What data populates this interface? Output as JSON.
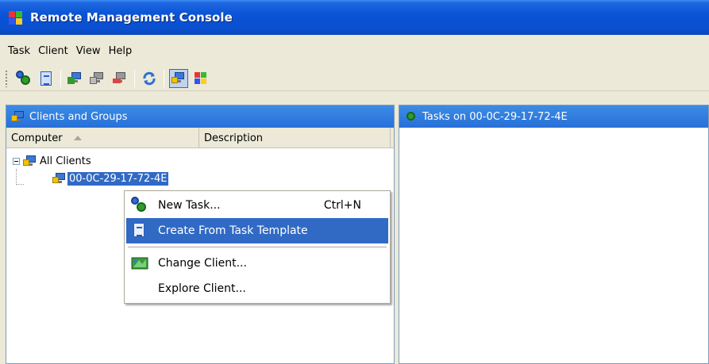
{
  "window": {
    "title": "Remote Management Console"
  },
  "menubar": {
    "items": [
      "Task",
      "Client",
      "View",
      "Help"
    ]
  },
  "toolbar": {
    "buttons": [
      "new-task-icon",
      "task-template-icon",
      "add-client-icon",
      "remove-client-icon",
      "change-client-icon",
      "refresh-icon",
      "view-clients-icon",
      "about-icon"
    ]
  },
  "left_pane": {
    "header": "Clients and Groups",
    "columns": {
      "computer": "Computer",
      "description": "Description"
    },
    "tree": {
      "root": "All Clients",
      "child": "00-0C-29-17-72-4E"
    }
  },
  "right_pane": {
    "header": "Tasks on 00-0C-29-17-72-4E"
  },
  "context_menu": {
    "items": [
      {
        "label": "New Task...",
        "shortcut": "Ctrl+N"
      },
      {
        "label": "Create From Task Template",
        "shortcut": ""
      },
      {
        "label": "Change Client...",
        "shortcut": ""
      },
      {
        "label": "Explore Client...",
        "shortcut": ""
      }
    ]
  },
  "colors": {
    "title_bar": "#0a54d6",
    "selection": "#316ac5",
    "pane_header": "#2870d8"
  }
}
